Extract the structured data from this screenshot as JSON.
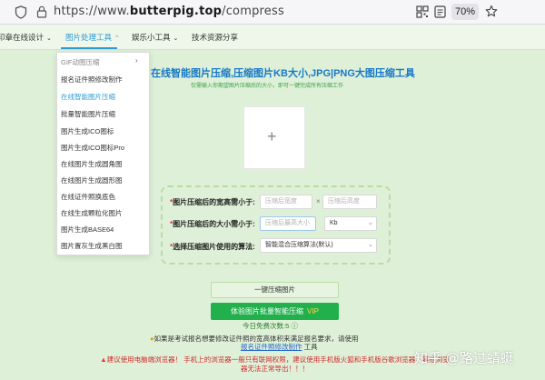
{
  "browser": {
    "url_prefix": "https://www.",
    "url_domain": "butterpig.top",
    "url_path": "/compress",
    "zoom": "70%"
  },
  "nav": {
    "items": [
      "印章在线设计",
      "图片处理工具",
      "娱乐小工具",
      "技术资源分享"
    ],
    "active_index": 1,
    "accent_color": "#2d9bd8"
  },
  "dropdown": {
    "items": [
      "GIF动图压缩",
      "报名证件照修改制作",
      "在线智能图片压缩",
      "批量智能图片压缩",
      "图片生成ICO图标",
      "图片生成ICO图标Pro",
      "在线图片生成圆角图",
      "在线图片生成圆形图",
      "在线证件照换底色",
      "在线生成颗粒化图片",
      "图片生成BASE64",
      "图片置灰生成黑白图"
    ],
    "active_index": 2
  },
  "main": {
    "title": "在线智能图片压缩,压缩图片KB大小,JPG|PNG大图压缩工具",
    "subtitle": "仅需输入你期望图片压缩后的大小，即可一键完成所有压缩工作",
    "width_label": "图片压缩后的宽高需小于:",
    "width_placeholder": "压缩后宽度",
    "height_placeholder": "压缩后高度",
    "times": "×",
    "size_label": "图片压缩后的大小需小于:",
    "size_placeholder": "压缩后最高大小",
    "size_unit": "Kb",
    "algo_label": "选择压缩图片使用的算法:",
    "algo_value": "智能混合压缩算法(默认)",
    "compress_button": "一键压缩图片",
    "batch_button": "体验图片批量智能压缩",
    "batch_badge": "VIP",
    "free_count": "今日免费次数:5",
    "notice_prefix": "如果是考试报名想要修改证件照的宽高体积来满足报名要求，请使用",
    "notice_link": "报名证件照修改制作",
    "notice_suffix": "工具",
    "warning": "建议使用电脑端浏览器！ 手机上的浏览器一般只有联网权限，建议使用手机版火狐和手机版谷歌浏览器，其他浏览器无法正常导出！！！",
    "brand_color": "#1779c6",
    "button_color": "#21b04b"
  },
  "watermark": "知乎 @路过蜻蜓"
}
